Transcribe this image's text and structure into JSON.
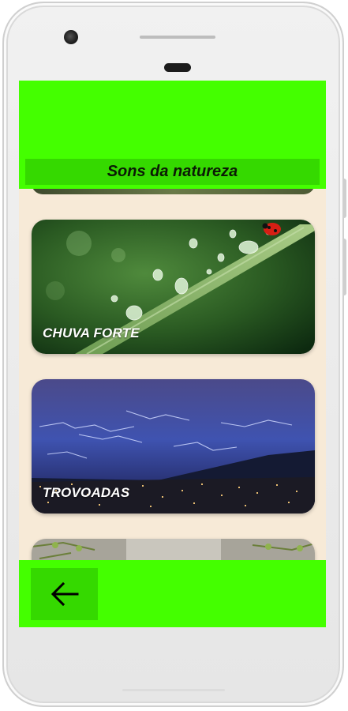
{
  "app": {
    "title": "Sons da natureza"
  },
  "cards": [
    {
      "label": "CHUVA FORTE",
      "image": "grass-blade-with-raindrops-and-ladybug"
    },
    {
      "label": "TROVOADAS",
      "image": "lightning-storm-over-city-at-night"
    },
    {
      "label": "",
      "image": "tree-branches-partial"
    }
  ],
  "navigation": {
    "back_icon": "arrow-left-icon"
  },
  "colors": {
    "bar_green": "#44ff00",
    "bar_green_dark": "#35d900",
    "background_cream": "#f7ead7"
  }
}
